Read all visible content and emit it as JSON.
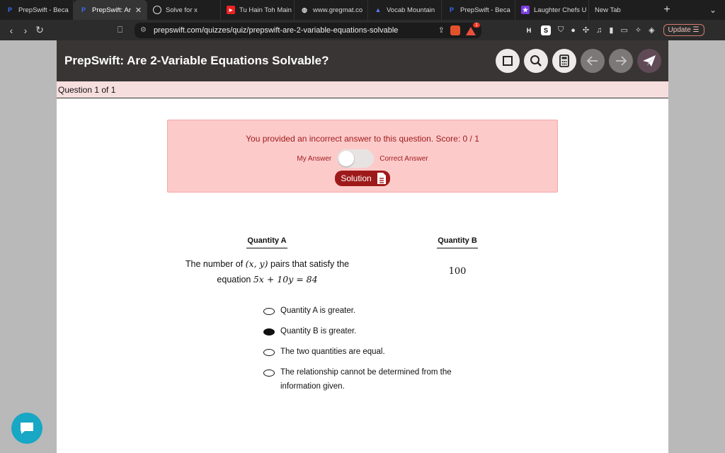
{
  "browser": {
    "tabs": [
      {
        "title": "PrepSwift - Beca",
        "active": false
      },
      {
        "title": "PrepSwift: Ar",
        "active": true
      },
      {
        "title": "Solve for x",
        "active": false
      },
      {
        "title": "Tu Hain Toh Main",
        "active": false
      },
      {
        "title": "www.gregmat.co",
        "active": false
      },
      {
        "title": "Vocab Mountain",
        "active": false
      },
      {
        "title": "PrepSwift - Beca",
        "active": false
      },
      {
        "title": "Laughter Chefs U",
        "active": false
      },
      {
        "title": "New Tab",
        "active": false
      }
    ],
    "url": "prepswift.com/quizzes/quiz/prepswift-are-2-variable-equations-solvable",
    "rewards_badge": "1",
    "update_label": "Update"
  },
  "page": {
    "title": "PrepSwift: Are 2-Variable Equations Solvable?",
    "question_counter": "Question 1 of 1",
    "feedback": {
      "message": "You provided an incorrect answer to this question. Score: 0 / 1",
      "my_answer_label": "My Answer",
      "correct_answer_label": "Correct Answer",
      "solution_label": "Solution"
    },
    "quantity_a": {
      "heading": "Quantity A",
      "line1_pre": "The number of ",
      "line1_math": "(x, y)",
      "line1_post": " pairs that satisfy the",
      "line2_pre": "equation ",
      "line2_math": "5x + 10y = 84"
    },
    "quantity_b": {
      "heading": "Quantity B",
      "value": "100"
    },
    "choices": [
      {
        "label": "Quantity A is greater.",
        "selected": false
      },
      {
        "label": "Quantity B is greater.",
        "selected": true
      },
      {
        "label": "The two quantities are equal.",
        "selected": false
      },
      {
        "label": "The relationship cannot be determined from the information given.",
        "selected": false
      }
    ]
  },
  "colors": {
    "header_bg": "#3a3535",
    "feedback_bg": "#fdcaca",
    "feedback_text": "#9e1a1a",
    "chat_button": "#18a7c4"
  }
}
